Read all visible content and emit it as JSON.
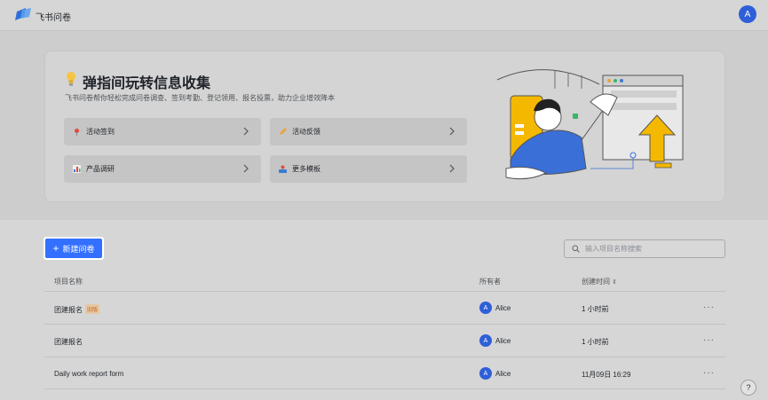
{
  "app": {
    "title": "飞书问卷",
    "avatar_letter": "A"
  },
  "hero": {
    "title": "弹指间玩转信息收集",
    "subtitle": "飞书问卷帮你轻松完成问卷调查、签到考勤、登记领用、报名投票，助力企业增效降本",
    "templates": [
      {
        "label": "活动签到",
        "icon": "pin-icon"
      },
      {
        "label": "活动反馈",
        "icon": "pencil-icon"
      },
      {
        "label": "产品调研",
        "icon": "chart-icon"
      },
      {
        "label": "更多模板",
        "icon": "templates-icon"
      }
    ]
  },
  "toolbar": {
    "new_label": "新建问卷",
    "search_placeholder": "输入项目名称搜索"
  },
  "table": {
    "headers": {
      "name": "项目名称",
      "owner": "所有者",
      "created": "创建时间"
    },
    "rows": [
      {
        "name": "团建报名",
        "tag": "旧版",
        "owner": "Alice",
        "owner_initial": "A",
        "created": "1 小时前",
        "more": "···"
      },
      {
        "name": "团建报名",
        "tag": "",
        "owner": "Alice",
        "owner_initial": "A",
        "created": "1 小时前",
        "more": "···"
      },
      {
        "name": "Daily work report form",
        "tag": "",
        "owner": "Alice",
        "owner_initial": "A",
        "created": "11月09日 16:29",
        "more": "···"
      }
    ]
  },
  "help": {
    "label": "?"
  },
  "colors": {
    "accent": "#3370ff",
    "avatar": "#2f5fd8",
    "tag_text": "#c06a1e",
    "illus_yellow": "#f5b800"
  }
}
